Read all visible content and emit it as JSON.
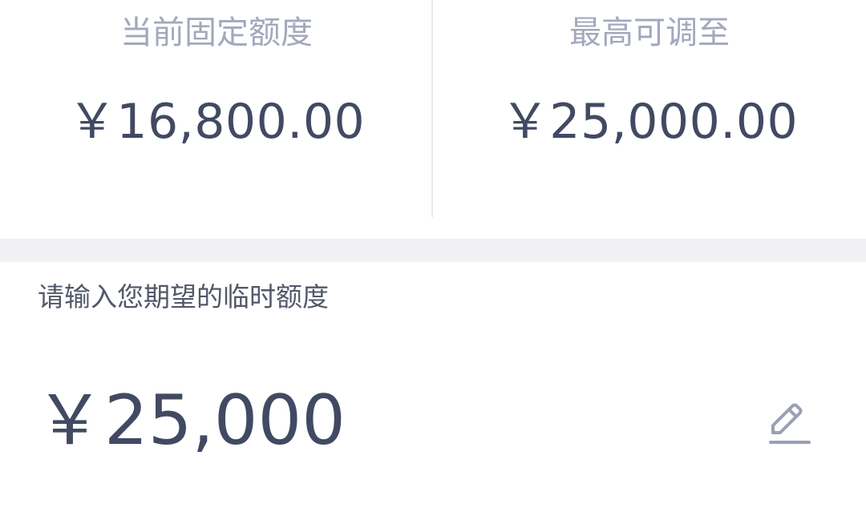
{
  "limits": {
    "current": {
      "label": "当前固定额度",
      "amount": "￥16,800.00"
    },
    "max": {
      "label": "最高可调至",
      "amount": "￥25,000.00"
    }
  },
  "temp_limit": {
    "prompt": "请输入您期望的临时额度",
    "amount": "￥25,000",
    "edit_icon": "pencil-icon"
  },
  "colors": {
    "label_gray": "#a3a8bd",
    "amount_dark": "#414a62",
    "edit_icon": "#9a9fb6",
    "section_gap": "#f1f1f3"
  }
}
